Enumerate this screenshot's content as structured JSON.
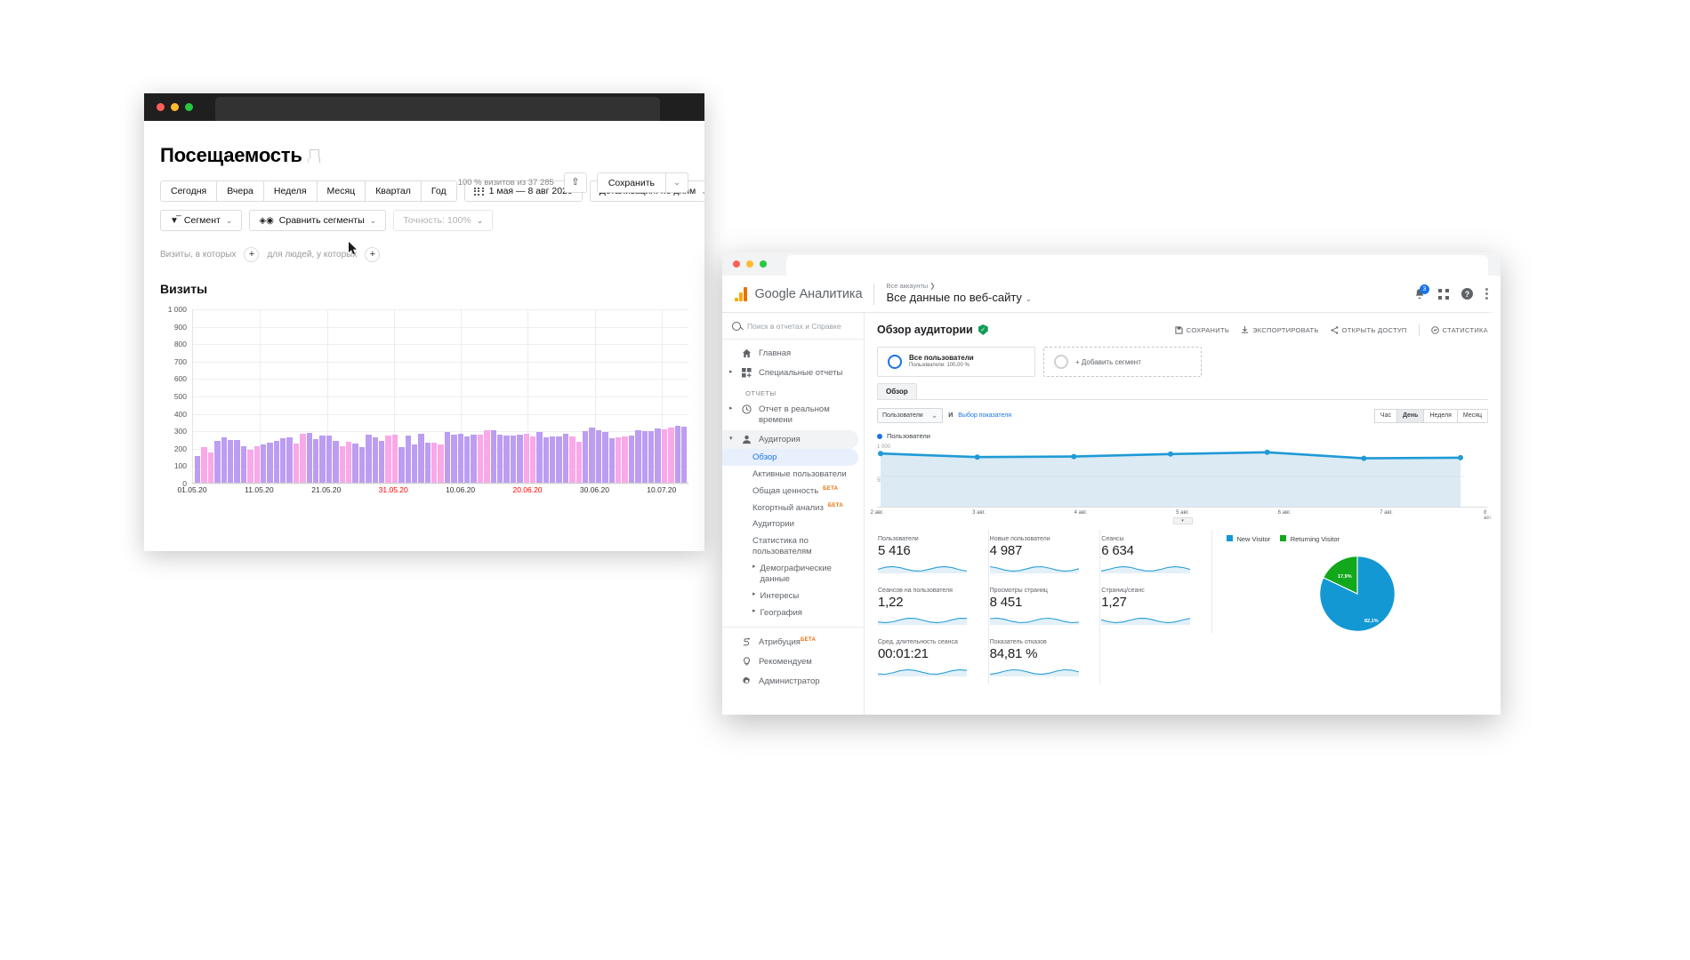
{
  "metrica": {
    "window_name": "Yandex Metrica",
    "title": "Посещаемость",
    "bookmark_icon": "bookmark-icon",
    "visits_note": "100 % визитов из 37 285",
    "share_icon": "share-icon",
    "save_label": "Сохранить",
    "caret_icon": "chevron-down-icon",
    "period_buttons": [
      "Сегодня",
      "Вчера",
      "Неделя",
      "Месяц",
      "Квартал",
      "Год"
    ],
    "date_range": "1 мая — 8 авг 2020",
    "calendar_icon": "calendar-icon",
    "detail_label": "Детализация: по дням",
    "segment_label": "Сегмент",
    "segment_icon": "funnel-icon",
    "compare_label": "Сравнить сегменты",
    "compare_icon": "compare-segments-icon",
    "accuracy_label": "Точность: 100%",
    "filter_left": "Визиты, в которых",
    "filter_right": "для людей, у которых",
    "plus_icon": "plus-icon",
    "chart_title": "Визиты"
  },
  "ga": {
    "window_name": "Google Analytics",
    "brand": "Google Аналитика",
    "logo_icon": "google-analytics-logo-icon",
    "account_crumb": "Все аккаунты ❯",
    "account_name": "Все данные по веб-сайту",
    "account_caret_icon": "chevron-down-icon",
    "bell_icon": "notifications-bell-icon",
    "bell_badge": "3",
    "apps_icon": "apps-grid-icon",
    "help_icon": "help-icon",
    "more_icon": "more-vertical-icon",
    "search_placeholder": "Поиск в отчетах и Справке",
    "search_icon": "search-icon",
    "nav": {
      "home": "Главная",
      "home_icon": "home-icon",
      "custom_reports": "Специальные отчеты",
      "custom_reports_icon": "custom-reports-icon",
      "section_reports": "ОТЧЕТЫ",
      "realtime": "Отчет в реальном времени",
      "realtime_icon": "clock-icon",
      "audience": "Аудитория",
      "audience_icon": "person-icon",
      "sub_items": [
        {
          "label": "Обзор",
          "selected": true
        },
        {
          "label": "Активные пользователи",
          "selected": false
        },
        {
          "label": "Общая ценность",
          "beta": "БЕТА",
          "selected": false
        },
        {
          "label": "Когортный анализ",
          "beta": "БЕТА",
          "selected": false
        },
        {
          "label": "Аудитории",
          "selected": false
        },
        {
          "label": "Статистика по пользователям",
          "selected": false
        },
        {
          "label": "Демографические данные",
          "arrow": true,
          "selected": false
        },
        {
          "label": "Интересы",
          "arrow": true,
          "selected": false
        },
        {
          "label": "География",
          "arrow": true,
          "selected": false
        }
      ],
      "attribution": "Атрибуция",
      "attribution_beta": "БЕТА",
      "attribution_icon": "attribution-icon",
      "recommend": "Рекомендуем",
      "recommend_icon": "lightbulb-icon",
      "admin": "Администратор",
      "admin_icon": "gear-icon"
    },
    "content_title": "Обзор аудитории",
    "verified_icon": "verified-shield-icon",
    "actions": [
      {
        "label": "СОХРАНИТЬ",
        "icon": "save-icon"
      },
      {
        "label": "ЭКСПОРТИРОВАТЬ",
        "icon": "export-icon"
      },
      {
        "label": "ОТКРЫТЬ ДОСТУП",
        "icon": "share-icon"
      },
      {
        "label": "СТАТИСТИКА",
        "icon": "insights-icon"
      }
    ],
    "segment_card": {
      "name": "Все пользователи",
      "sub": "Пользователи: 100,00 %",
      "ring_icon": "segment-ring-icon"
    },
    "add_segment": {
      "label": "+ Добавить сегмент",
      "ring_icon": "segment-ring-empty-icon"
    },
    "tab": "Обзор",
    "metric_select": "Пользователи",
    "select_caret_icon": "chevron-down-icon",
    "and_label": "И",
    "select_metric_link": "Выбор показателя",
    "granularity": [
      "Час",
      "День",
      "Неделя",
      "Месяц"
    ],
    "granularity_active": "День",
    "legend": "Пользователи",
    "metrics": [
      {
        "label": "Пользователи",
        "value": "5 416"
      },
      {
        "label": "Новые пользователи",
        "value": "4 987"
      },
      {
        "label": "Сеансы",
        "value": "6 634"
      },
      {
        "label": "Сеансов на пользователя",
        "value": "1,22"
      },
      {
        "label": "Просмотры страниц",
        "value": "8 451"
      },
      {
        "label": "Страниц/сеанс",
        "value": "1,27"
      },
      {
        "label": "Сред. длительность сеанса",
        "value": "00:01:21"
      },
      {
        "label": "Показатель отказов",
        "value": "84,81 %"
      }
    ]
  },
  "chart_data": [
    {
      "type": "bar",
      "title": "Визиты",
      "xlabel": "",
      "ylabel": "",
      "ylim": [
        0,
        1000
      ],
      "ytick_labels": [
        "0",
        "100",
        "200",
        "300",
        "400",
        "500",
        "600",
        "700",
        "800",
        "900",
        "1 000"
      ],
      "xtick_labels": [
        "01.05.20",
        "11.05.20",
        "21.05.20",
        "31.05.20",
        "10.06.20",
        "20.06.20",
        "30.06.20",
        "10.07.20"
      ],
      "xtick_weekend": [
        "31.05.20",
        "20.06.20"
      ],
      "grid": true,
      "colors": {
        "weekday": "#bc9df2",
        "weekend": "#f9a8e8"
      },
      "values": [
        153,
        202,
        172,
        242,
        259,
        246,
        247,
        210,
        189,
        208,
        222,
        232,
        238,
        256,
        259,
        226,
        280,
        288,
        250,
        273,
        271,
        239,
        210,
        234,
        226,
        205,
        274,
        262,
        242,
        272,
        275,
        205,
        271,
        222,
        281,
        232,
        230,
        222,
        293,
        276,
        280,
        265,
        275,
        277,
        300,
        301,
        274,
        271,
        268,
        275,
        283,
        265,
        291,
        258,
        263,
        266,
        279,
        265,
        236,
        297,
        318,
        301,
        293,
        256,
        260,
        267,
        272,
        299,
        295,
        294,
        311,
        307,
        315,
        329,
        322
      ],
      "weekend_indices": [
        1,
        2,
        8,
        9,
        15,
        16,
        22,
        23,
        29,
        30,
        36,
        37,
        43,
        44,
        50,
        51,
        57,
        58,
        64,
        65,
        71,
        72
      ]
    },
    {
      "type": "area",
      "title": "Пользователи",
      "x": [
        "2 авг.",
        "3 авг.",
        "4 авг.",
        "5 авг.",
        "6 авг.",
        "7 авг.",
        "8 авг."
      ],
      "values": [
        880,
        820,
        830,
        870,
        900,
        800,
        810
      ],
      "ylim": [
        0,
        1000
      ],
      "ytick_labels": [
        "1 000",
        "500"
      ],
      "grid": true,
      "color": "#1f9ad6"
    },
    {
      "type": "pie",
      "title": "",
      "labels": [
        "New Visitor",
        "Returning Visitor"
      ],
      "values": [
        82.1,
        17.9
      ],
      "value_labels": [
        "82,1%",
        "17,9%"
      ],
      "colors": [
        "#1398d4",
        "#11a81b"
      ],
      "legend_position": "top"
    }
  ]
}
